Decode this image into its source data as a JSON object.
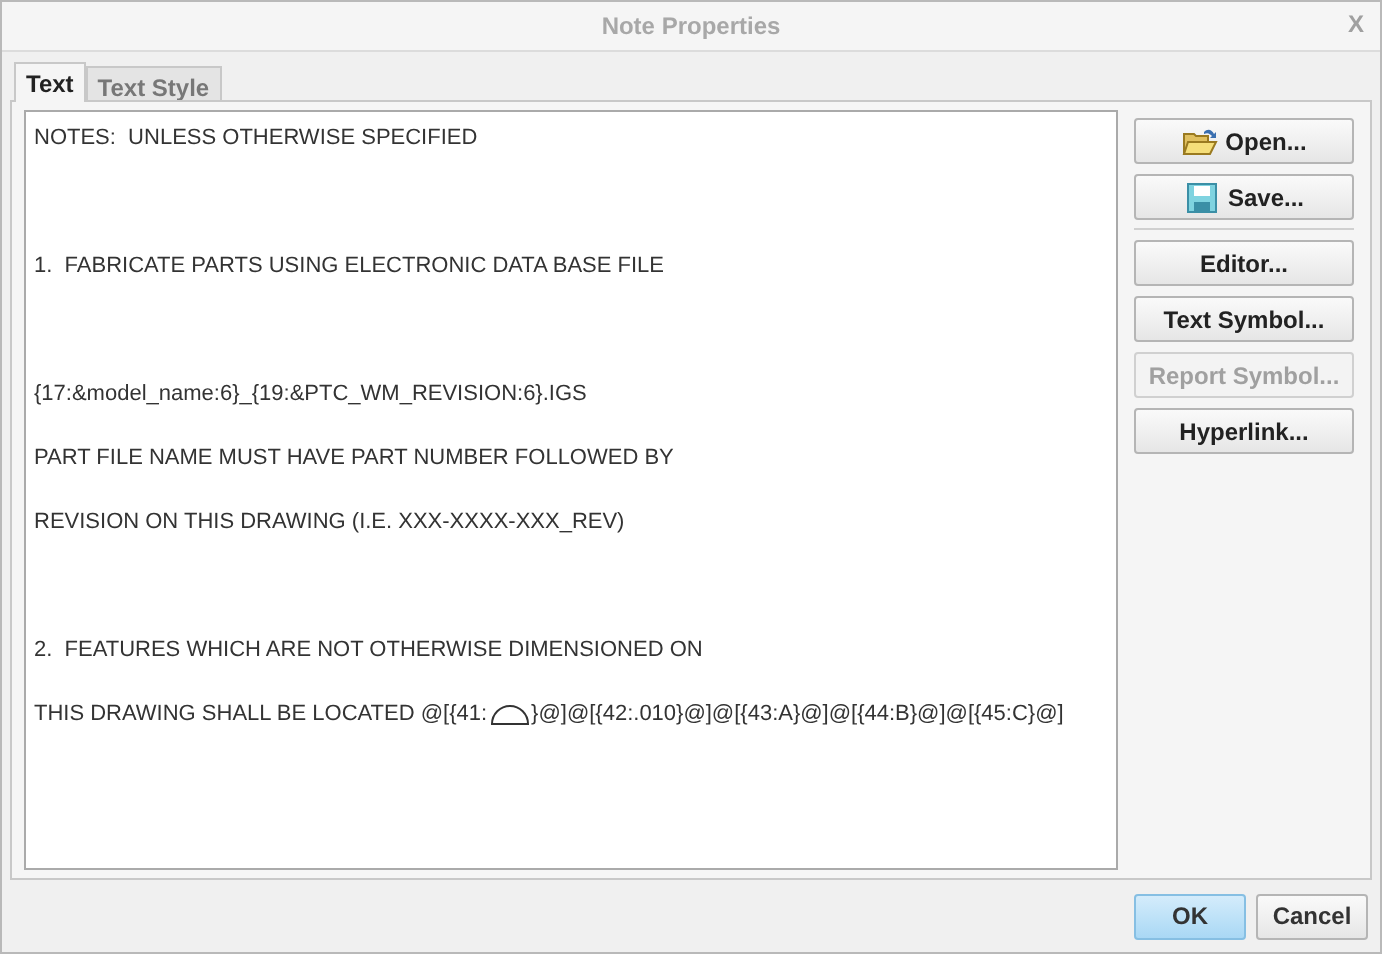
{
  "window": {
    "title": "Note Properties",
    "close": "X"
  },
  "tabs": [
    {
      "label": "Text",
      "selected": true
    },
    {
      "label": "Text Style",
      "selected": false
    }
  ],
  "note_lines": [
    {
      "space_before": false,
      "parts": [
        {
          "kind": "text",
          "text": "NOTES:  UNLESS OTHERWISE SPECIFIED"
        }
      ]
    },
    {
      "space_before": true,
      "parts": [
        {
          "kind": "text",
          "text": "1.  FABRICATE PARTS USING ELECTRONIC DATA BASE FILE"
        }
      ]
    },
    {
      "space_before": true,
      "parts": [
        {
          "kind": "text",
          "text": "{17:&model_name:6}_{19:&PTC_WM_REVISION:6}.IGS"
        }
      ]
    },
    {
      "space_before": false,
      "parts": [
        {
          "kind": "text",
          "text": "PART FILE NAME MUST HAVE PART NUMBER FOLLOWED BY"
        }
      ]
    },
    {
      "space_before": false,
      "parts": [
        {
          "kind": "text",
          "text": "REVISION ON THIS DRAWING (I.E. XXX-XXXX-XXX_REV)"
        }
      ]
    },
    {
      "space_before": true,
      "parts": [
        {
          "kind": "text",
          "text": "2.  FEATURES WHICH ARE NOT OTHERWISE DIMENSIONED ON"
        }
      ]
    },
    {
      "space_before": false,
      "parts": [
        {
          "kind": "text",
          "text": "THIS DRAWING SHALL BE LOCATED @[{41:"
        },
        {
          "kind": "profile-symbol"
        },
        {
          "kind": "text",
          "text": "}@]@[{42:.010}@]@[{43:A}@]@[{44:B}@]@[{45:C}@]"
        }
      ]
    }
  ],
  "side_button_groups": [
    [
      {
        "label": "Open...",
        "kind": "open",
        "disabled": false
      },
      {
        "label": "Save...",
        "kind": "save",
        "disabled": false
      }
    ],
    [
      {
        "label": "Editor...",
        "kind": "plain",
        "disabled": false
      },
      {
        "label": "Text Symbol...",
        "kind": "plain",
        "disabled": false
      },
      {
        "label": "Report Symbol...",
        "kind": "plain",
        "disabled": true
      },
      {
        "label": "Hyperlink...",
        "kind": "plain",
        "disabled": false
      }
    ]
  ],
  "footer_buttons": [
    {
      "label": "OK",
      "default": true
    },
    {
      "label": "Cancel",
      "default": false
    }
  ]
}
